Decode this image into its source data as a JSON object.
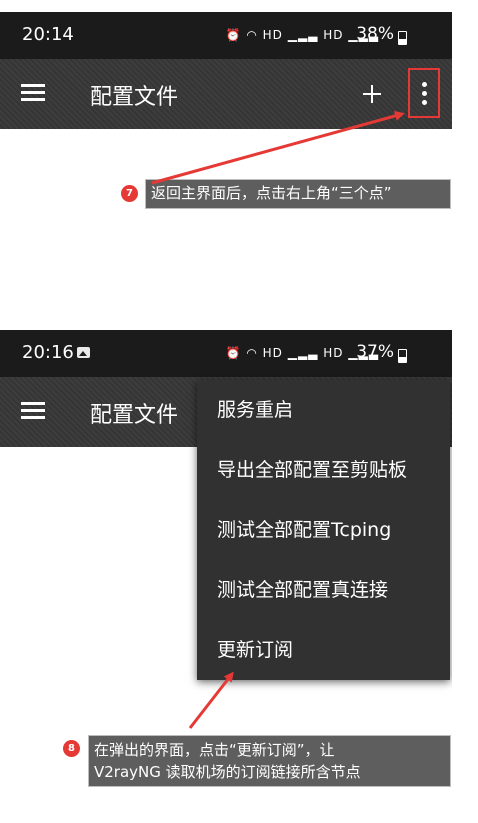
{
  "screen1": {
    "status_time": "20:14",
    "status_icons": "⏰ ◠ HD ▁▂▃ HD ▁▂▃",
    "battery": "38%",
    "title": "配置文件",
    "add_icon": "plus-icon",
    "more_icon": "more-vert-icon"
  },
  "callout1": {
    "number": "7",
    "text": "返回主界面后，点击右上角“三个点”"
  },
  "screen2": {
    "status_time": "20:16",
    "status_icons": "⏰ ◠ HD ▁▂▃ HD ▁▂▃",
    "battery": "37%",
    "title": "配置文件",
    "menu": [
      {
        "label": "服务重启"
      },
      {
        "label": "导出全部配置至剪贴板"
      },
      {
        "label": "测试全部配置Tcping"
      },
      {
        "label": "测试全部配置真连接"
      },
      {
        "label": "更新订阅"
      }
    ]
  },
  "callout2": {
    "number": "8",
    "line1": "在弹出的界面，点击“更新订阅”，让",
    "line2": "V2rayNG 读取机场的订阅链接所含节点"
  },
  "colors": {
    "status_bar": "#1b1b1b",
    "toolbar": "#3a3a3a",
    "menu": "#313131",
    "annotation_red": "#e53935",
    "callout_bg": "#484848"
  }
}
